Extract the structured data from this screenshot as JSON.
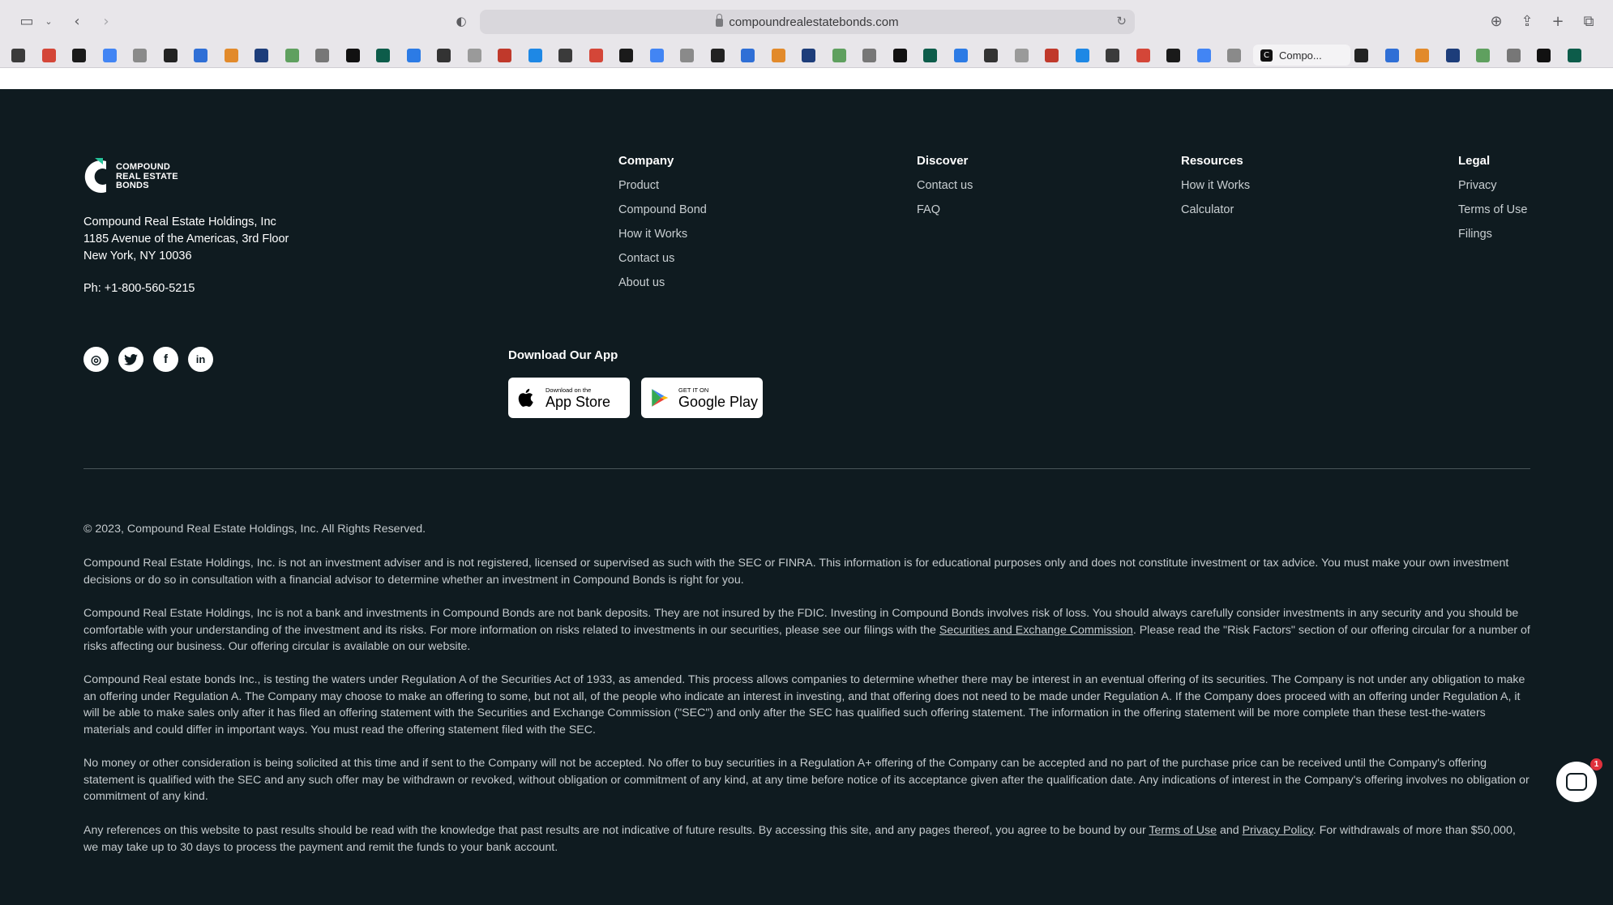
{
  "browser": {
    "url": "compoundrealestatebonds.com",
    "active_tab_title": "Compo...",
    "active_tab_icon": "compound-favicon",
    "bookmark_count": 49
  },
  "footer": {
    "logo": {
      "text_line1": "COMPOUND",
      "text_line2": "REAL ESTATE",
      "text_line3": "BONDS"
    },
    "address": {
      "company": "Compound Real Estate Holdings, Inc",
      "street": "1185 Avenue of the Americas, 3rd Floor",
      "city": "New York, NY 10036"
    },
    "phone": "Ph: +1-800-560-5215",
    "socials": [
      {
        "name": "instagram-icon",
        "glyph": "◎"
      },
      {
        "name": "twitter-icon",
        "glyph": "🐦"
      },
      {
        "name": "facebook-icon",
        "glyph": "f"
      },
      {
        "name": "linkedin-icon",
        "glyph": "in"
      }
    ],
    "columns": {
      "company": {
        "title": "Company",
        "links": [
          "Product",
          "Compound Bond",
          "How it Works",
          "Contact us",
          "About us"
        ]
      },
      "discover": {
        "title": "Discover",
        "links": [
          "Contact us",
          "FAQ"
        ]
      },
      "resources": {
        "title": "Resources",
        "links": [
          "How it Works",
          "Calculator"
        ]
      },
      "legal": {
        "title": "Legal",
        "links": [
          "Privacy",
          "Terms of Use",
          "Filings"
        ]
      }
    },
    "app": {
      "title": "Download Our App",
      "app_store": {
        "sub": "Download on the",
        "main": "App Store"
      },
      "google_play": {
        "sub": "GET IT ON",
        "main": "Google Play"
      }
    },
    "copyright": "© 2023, Compound Real Estate Holdings, Inc. All Rights Reserved.",
    "disclaimer1": "Compound Real Estate Holdings, Inc. is not an investment adviser and is not registered, licensed or supervised as such with the SEC or FINRA. This information is for educational purposes only and does not constitute investment or tax advice. You must make your own investment decisions or do so in consultation with a financial advisor to determine whether an investment in Compound Bonds is right for you.",
    "disclaimer2_before": "Compound Real Estate Holdings, Inc is not a bank and investments in Compound Bonds are not bank deposits. They are not insured by the FDIC. Investing in Compound Bonds involves risk of loss. You should always carefully consider investments in any security and you should be comfortable with your understanding of the investment and its risks. For more information on risks related to investments in our securities, please see our filings with the ",
    "disclaimer2_link": "Securities and Exchange Commission",
    "disclaimer2_after": ". Please read the \"Risk Factors\" section of our offering circular for a number of risks affecting our business. Our offering circular is available on our website.",
    "disclaimer3": "Compound Real estate bonds Inc., is testing the waters under Regulation A of the Securities Act of 1933, as amended. This process allows companies to determine whether there may be interest in an eventual offering of its securities. The Company is not under any obligation to make an offering under Regulation A. The Company may choose to make an offering to some, but not all, of the people who indicate an interest in investing, and that offering does not need to be made under Regulation A. If the Company does proceed with an offering under Regulation A, it will be able to make sales only after it has filed an offering statement with the Securities and Exchange Commission (\"SEC\") and only after the SEC has qualified such offering statement. The information in the offering statement will be more complete than these test-the-waters materials and could differ in important ways. You must read the offering statement filed with the SEC.",
    "disclaimer4": "No money or other consideration is being solicited at this time and if sent to the Company will not be accepted. No offer to buy securities in a Regulation A+ offering of the Company can be accepted and no part of the purchase price can be received until the Company's offering statement is qualified with the SEC and any such offer may be withdrawn or revoked, without obligation or commitment of any kind, at any time before notice of its acceptance given after the qualification date. Any indications of interest in the Company's offering involves no obligation or commitment of any kind.",
    "disclaimer5_before": "Any references on this website to past results should be read with the knowledge that past results are not indicative of future results. By accessing this site, and any pages thereof, you agree to be bound by our ",
    "disclaimer5_link1": "Terms of Use",
    "disclaimer5_mid": " and ",
    "disclaimer5_link2": "Privacy Policy",
    "disclaimer5_after": ". For withdrawals of more than $50,000, we may take up to 30 days to process the payment and remit the funds to your bank account."
  },
  "chat": {
    "badge": "1"
  },
  "colors": {
    "footer_bg": "#0f1b20",
    "text_muted": "#c4cacd",
    "white": "#ffffff",
    "badge": "#e0313c"
  }
}
